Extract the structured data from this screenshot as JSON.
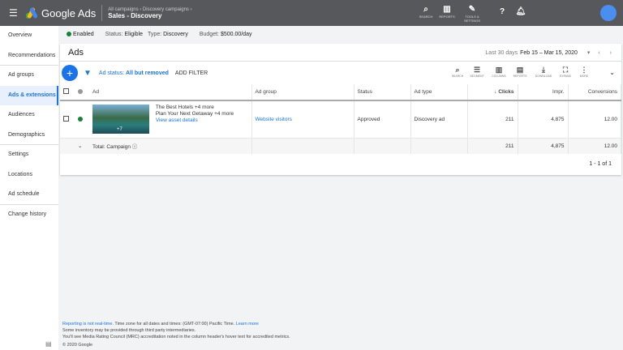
{
  "topbar": {
    "brand": "Google Ads",
    "crumb": "All campaigns  ›  Discovery campaigns  ›",
    "campaign": "Sales - Discovery",
    "icons": [
      {
        "name": "search",
        "label": "SEARCH",
        "glyph": "⌕"
      },
      {
        "name": "reports",
        "label": "REPORTS",
        "glyph": "▥"
      },
      {
        "name": "tools",
        "label": "TOOLS & SETTINGS",
        "glyph": "🔧"
      }
    ]
  },
  "sidebar": {
    "items": [
      "Overview",
      "Recommendations",
      "Ad groups",
      "Ads & extensions",
      "Audiences",
      "Demographics",
      "Settings",
      "Locations",
      "Ad schedule",
      "Change history"
    ]
  },
  "status": {
    "enabled": "Enabled",
    "status_label": "Status:",
    "status": "Eligible",
    "type_label": "Type:",
    "type": "Discovery",
    "budget_label": "Budget:",
    "budget": "$500.00/day"
  },
  "page": {
    "title": "Ads",
    "date_range_label": "Last 30 days",
    "date_range": "Feb 15 – Mar 15, 2020"
  },
  "toolbar": {
    "filter": "Ad status:",
    "filter_value": "All but removed",
    "add_filter": "ADD FILTER",
    "tools": [
      "SEARCH",
      "SEGMENT",
      "COLUMNS",
      "REPORTS",
      "DOWNLOAD",
      "EXPAND",
      "MORE"
    ]
  },
  "table": {
    "headers": [
      "Ad",
      "Ad group",
      "Status",
      "Ad type",
      "Clicks",
      "Impr.",
      "Conversions"
    ],
    "row": {
      "headline": "The Best Hotels +4 more",
      "description": "Plan Your Next Getaway +4 more",
      "asset_link": "View asset details",
      "image_more": "+7",
      "ad_group": "Website visitors",
      "status": "Approved",
      "ad_type": "Discovery ad",
      "clicks": "211",
      "impr": "4,875",
      "conversions": "12.00"
    },
    "total": {
      "label": "Total: Campaign",
      "clicks": "211",
      "impr": "4,875",
      "conversions": "12.00"
    },
    "pagination": "1 - 1 of 1"
  },
  "footer": {
    "link1": "Reporting is not real-time.",
    "line1": " Time zone for all dates and times: (GMT-07:00) Pacific Time. ",
    "link2": "Learn more",
    "line2": "Some inventory may be provided through third party intermediaries.",
    "line3": "You'll see Media Rating Council (MRC) accreditation noted in the column header's hover text for accredited metrics.",
    "copyright": "© 2020 Google"
  }
}
